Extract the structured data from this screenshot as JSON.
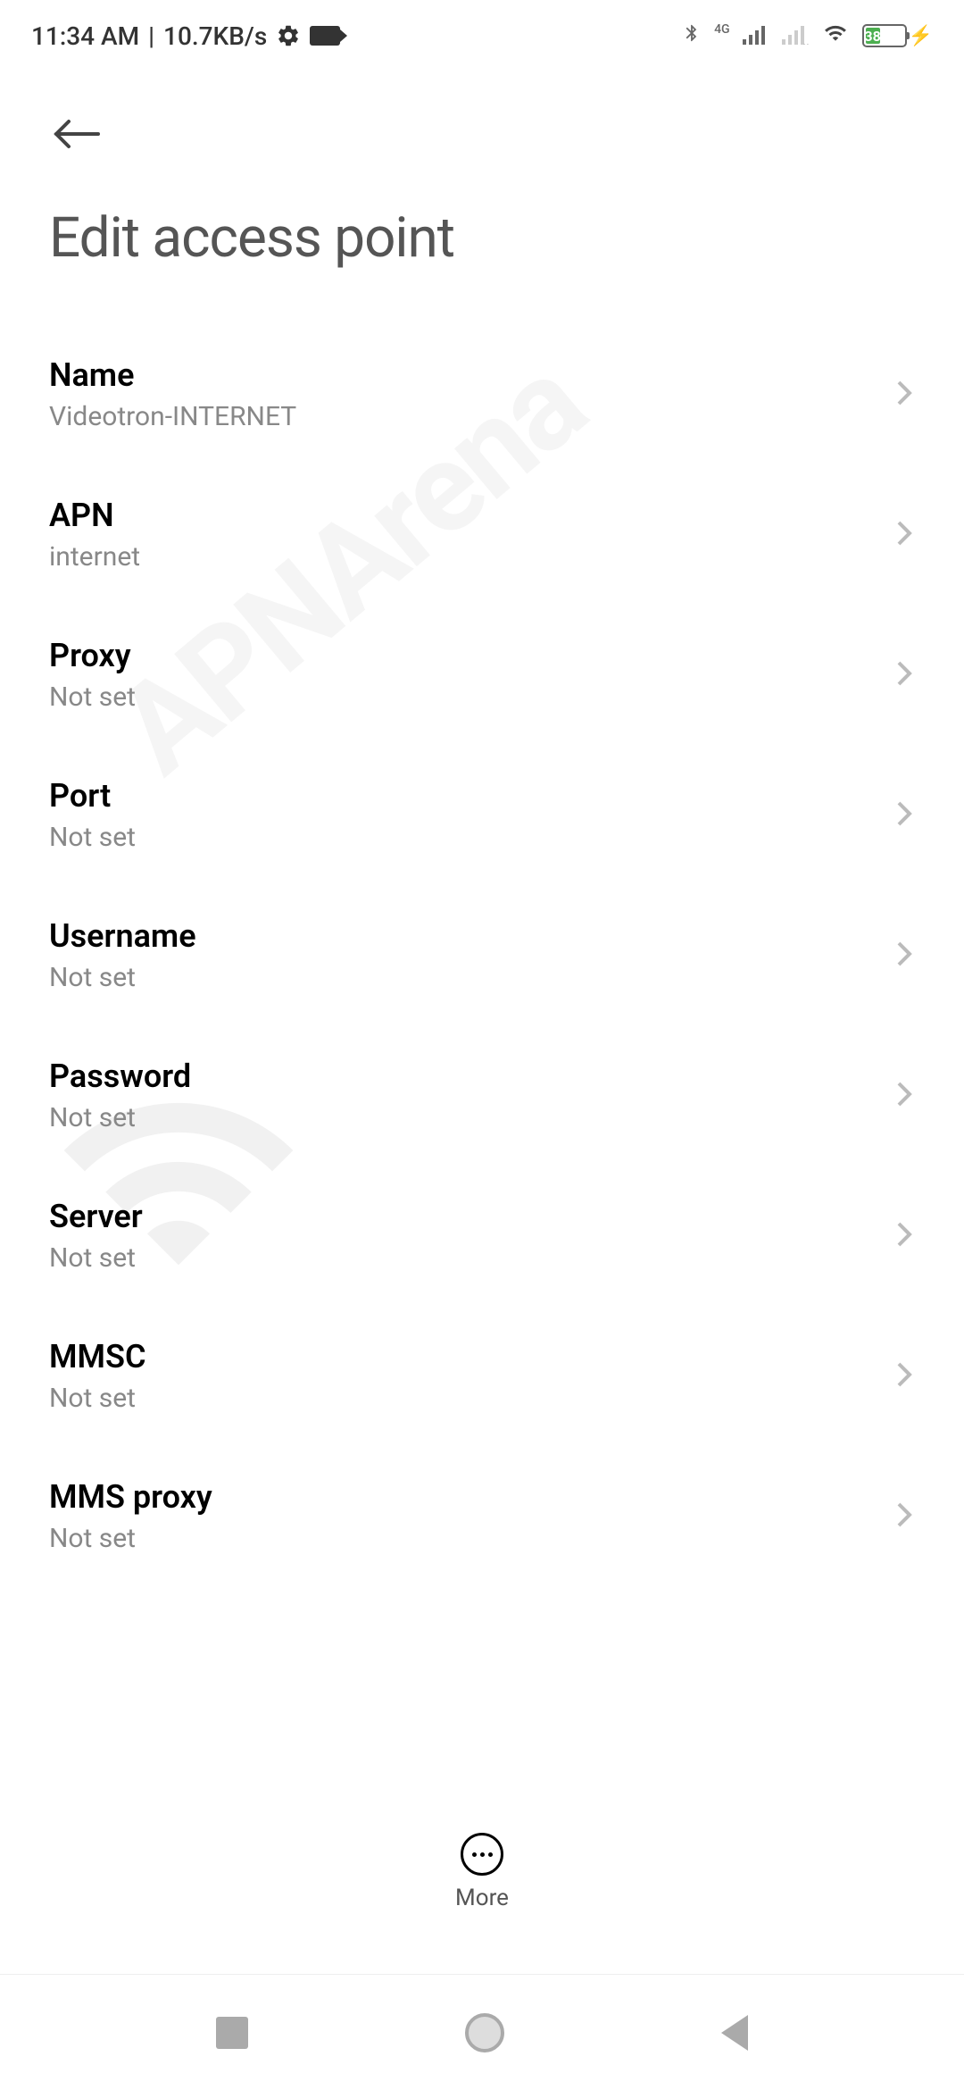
{
  "status_bar": {
    "time": "11:34 AM",
    "data_rate": "10.7KB/s",
    "network_type": "4G",
    "battery_percent": "38"
  },
  "header": {
    "title": "Edit access point"
  },
  "settings": [
    {
      "label": "Name",
      "value": "Videotron-INTERNET"
    },
    {
      "label": "APN",
      "value": "internet"
    },
    {
      "label": "Proxy",
      "value": "Not set"
    },
    {
      "label": "Port",
      "value": "Not set"
    },
    {
      "label": "Username",
      "value": "Not set"
    },
    {
      "label": "Password",
      "value": "Not set"
    },
    {
      "label": "Server",
      "value": "Not set"
    },
    {
      "label": "MMSC",
      "value": "Not set"
    },
    {
      "label": "MMS proxy",
      "value": "Not set"
    }
  ],
  "bottom_action": {
    "label": "More"
  },
  "watermark": "APNArena"
}
